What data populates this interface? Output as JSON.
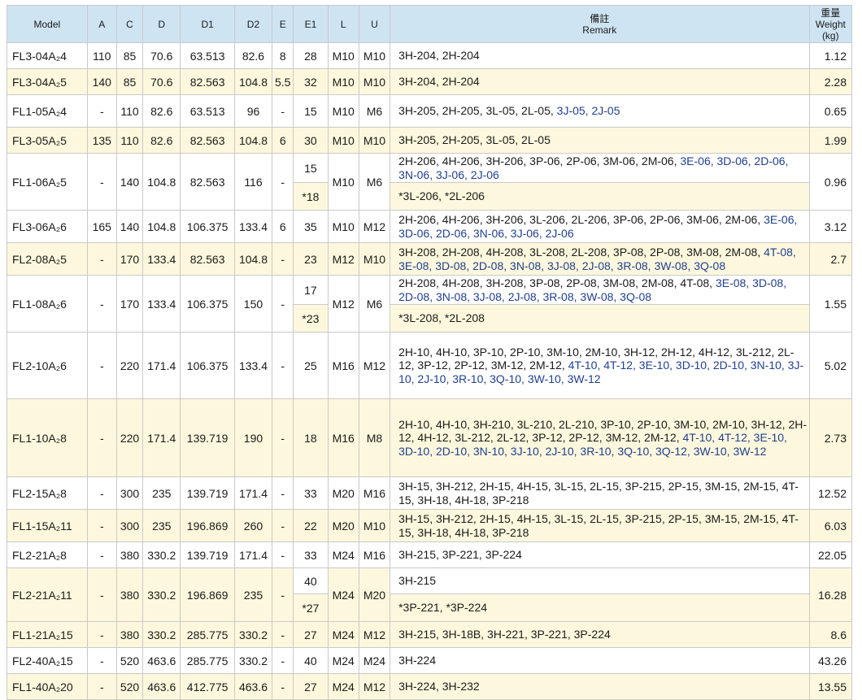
{
  "headers": {
    "model": "Model",
    "a": "A",
    "c": "C",
    "d": "D",
    "d1": "D1",
    "d2": "D2",
    "e": "E",
    "e1": "E1",
    "l": "L",
    "u": "U",
    "remark_cn": "備註",
    "remark_en": "Remark",
    "weight_cn": "重量",
    "weight_en": "Weight",
    "weight_unit": "(kg)"
  },
  "rows": [
    {
      "model": "FL3-04A₂4",
      "a": "110",
      "c": "85",
      "d": "70.6",
      "d1": "63.513",
      "d2": "82.6",
      "e": "8",
      "e1": "28",
      "l": "M10",
      "u": "M10",
      "remark": "3H-204, 2H-204",
      "remark_blue": "",
      "weight": "1.12"
    },
    {
      "model": "FL3-04A₂5",
      "a": "140",
      "c": "85",
      "d": "70.6",
      "d1": "82.563",
      "d2": "104.8",
      "e": "5.5",
      "e1": "32",
      "l": "M10",
      "u": "M10",
      "remark": "3H-204, 2H-204",
      "remark_blue": "",
      "weight": "2.28"
    },
    {
      "model": "FL1-05A₂4",
      "a": "-",
      "c": "110",
      "d": "82.6",
      "d1": "63.513",
      "d2": "96",
      "e": "-",
      "e1": "15",
      "l": "M10",
      "u": "M6",
      "remark": "3H-205, 2H-205, 3L-05, 2L-05,",
      "remark_blue": "3J-05, 2J-05",
      "weight": "0.65"
    },
    {
      "model": "FL3-05A₂5",
      "a": "135",
      "c": "110",
      "d": "82.6",
      "d1": "82.563",
      "d2": "104.8",
      "e": "6",
      "e1": "30",
      "l": "M10",
      "u": "M10",
      "remark": "3H-205, 2H-205, 3L-05, 2L-05",
      "remark_blue": "",
      "weight": "1.99"
    },
    {
      "model": "FL1-06A₂5",
      "a": "-",
      "c": "140",
      "d": "104.8",
      "d1": "82.563",
      "d2": "116",
      "e": "-",
      "e1": "15",
      "e1b": "*18",
      "l": "M10",
      "u": "M6",
      "remark": "2H-206, 4H-206, 3H-206, 3P-06, 2P-06, 3M-06, 2M-06,",
      "remark_blue": "3E-06, 3D-06, 2D-06, 3N-06, 3J-06, 2J-06",
      "remark_b": "*3L-206, *2L-206",
      "weight": "0.96"
    },
    {
      "model": "FL3-06A₂6",
      "a": "165",
      "c": "140",
      "d": "104.8",
      "d1": "106.375",
      "d2": "133.4",
      "e": "6",
      "e1": "35",
      "l": "M10",
      "u": "M12",
      "remark": "2H-206, 4H-206, 3H-206, 3L-206, 2L-206, 3P-06, 2P-06, 3M-06, 2M-06,",
      "remark_blue": "3E-06, 3D-06, 2D-06, 3N-06, 3J-06, 2J-06",
      "weight": "3.12"
    },
    {
      "model": "FL2-08A₂5",
      "a": "-",
      "c": "170",
      "d": "133.4",
      "d1": "82.563",
      "d2": "104.8",
      "e": "-",
      "e1": "23",
      "l": "M12",
      "u": "M10",
      "remark": "3H-208, 2H-208, 4H-208, 3L-208, 2L-208, 3P-08, 2P-08, 3M-08, 2M-08,",
      "remark_blue": "4T-08, 3E-08, 3D-08, 2D-08, 3N-08, 3J-08, 2J-08, 3R-08, 3W-08, 3Q-08",
      "weight": "2.7"
    },
    {
      "model": "FL1-08A₂6",
      "a": "-",
      "c": "170",
      "d": "133.4",
      "d1": "106.375",
      "d2": "150",
      "e": "-",
      "e1": "17",
      "e1b": "*23",
      "l": "M12",
      "u": "M6",
      "remark": "2H-208, 4H-208, 3H-208, 3P-08, 2P-08, 3M-08, 2M-08, 4T-08,",
      "remark_blue": "3E-08, 3D-08, 2D-08, 3N-08, 3J-08, 2J-08, 3R-08, 3W-08, 3Q-08",
      "remark_b": "*3L-208, *2L-208",
      "weight": "1.55"
    },
    {
      "model": "FL2-10A₂6",
      "a": "-",
      "c": "220",
      "d": "171.4",
      "d1": "106.375",
      "d2": "133.4",
      "e": "-",
      "e1": "25",
      "l": "M16",
      "u": "M12",
      "remark": "2H-10, 4H-10, 3P-10, 2P-10, 3M-10, 2M-10, 3H-12, 2H-12, 4H-12, 3L-212, 2L-12, 3P-12, 2P-12, 3M-12, 2M-12,",
      "remark_blue": "4T-10, 4T-12, 3E-10, 3D-10, 2D-10, 3N-10, 3J-10, 2J-10, 3R-10, 3Q-10, 3W-10, 3W-12",
      "weight": "5.02"
    },
    {
      "model": "FL1-10A₂8",
      "a": "-",
      "c": "220",
      "d": "171.4",
      "d1": "139.719",
      "d2": "190",
      "e": "-",
      "e1": "18",
      "l": "M16",
      "u": "M8",
      "remark": "2H-10, 4H-10, 3H-210, 3L-210, 2L-210, 3P-10, 2P-10, 3M-10, 2M-10, 3H-12, 2H-12, 4H-12, 3L-212, 2L-12, 3P-12, 2P-12, 3M-12, 2M-12,",
      "remark_blue": "4T-10, 4T-12, 3E-10, 3D-10, 2D-10, 3N-10, 3J-10, 2J-10, 3R-10, 3Q-10, 3Q-12, 3W-10, 3W-12",
      "weight": "2.73"
    },
    {
      "model": "FL2-15A₂8",
      "a": "-",
      "c": "300",
      "d": "235",
      "d1": "139.719",
      "d2": "171.4",
      "e": "-",
      "e1": "33",
      "l": "M20",
      "u": "M16",
      "remark": "3H-15, 3H-212, 2H-15, 4H-15, 3L-15, 2L-15, 3P-215, 2P-15, 3M-15, 2M-15, 4T-15, 3H-18, 4H-18, 3P-218",
      "remark_blue": "",
      "weight": "12.52"
    },
    {
      "model": "FL1-15A₂11",
      "a": "-",
      "c": "300",
      "d": "235",
      "d1": "196.869",
      "d2": "260",
      "e": "-",
      "e1": "22",
      "l": "M20",
      "u": "M10",
      "remark": "3H-15, 3H-212, 2H-15, 4H-15, 3L-15, 2L-15, 3P-215, 2P-15, 3M-15, 2M-15, 4T-15, 3H-18, 4H-18, 3P-218",
      "remark_blue": "",
      "weight": "6.03"
    },
    {
      "model": "FL2-21A₂8",
      "a": "-",
      "c": "380",
      "d": "330.2",
      "d1": "139.719",
      "d2": "171.4",
      "e": "-",
      "e1": "33",
      "l": "M24",
      "u": "M16",
      "remark": "3H-215, 3P-221, 3P-224",
      "remark_blue": "",
      "weight": "22.05"
    },
    {
      "model": "FL2-21A₂11",
      "a": "-",
      "c": "380",
      "d": "330.2",
      "d1": "196.869",
      "d2": "235",
      "e": "-",
      "e1": "40",
      "e1b": "*27",
      "l": "M24",
      "u": "M20",
      "remark": "3H-215",
      "remark_blue": "",
      "remark_b": "*3P-221, *3P-224",
      "weight": "16.28"
    },
    {
      "model": "FL1-21A₂15",
      "a": "-",
      "c": "380",
      "d": "330.2",
      "d1": "285.775",
      "d2": "330.2",
      "e": "-",
      "e1": "27",
      "l": "M24",
      "u": "M12",
      "remark": "3H-215, 3H-18B, 3H-221, 3P-221, 3P-224",
      "remark_blue": "",
      "weight": "8.6"
    },
    {
      "model": "FL2-40A₂15",
      "a": "-",
      "c": "520",
      "d": "463.6",
      "d1": "285.775",
      "d2": "330.2",
      "e": "-",
      "e1": "40",
      "l": "M24",
      "u": "M24",
      "remark": "3H-224",
      "remark_blue": "",
      "weight": "43.26"
    },
    {
      "model": "FL1-40A₂20",
      "a": "-",
      "c": "520",
      "d": "463.6",
      "d1": "412.775",
      "d2": "463.6",
      "e": "-",
      "e1": "27",
      "l": "M24",
      "u": "M12",
      "remark": "3H-224, 3H-232",
      "remark_blue": "",
      "weight": "13.55"
    }
  ]
}
